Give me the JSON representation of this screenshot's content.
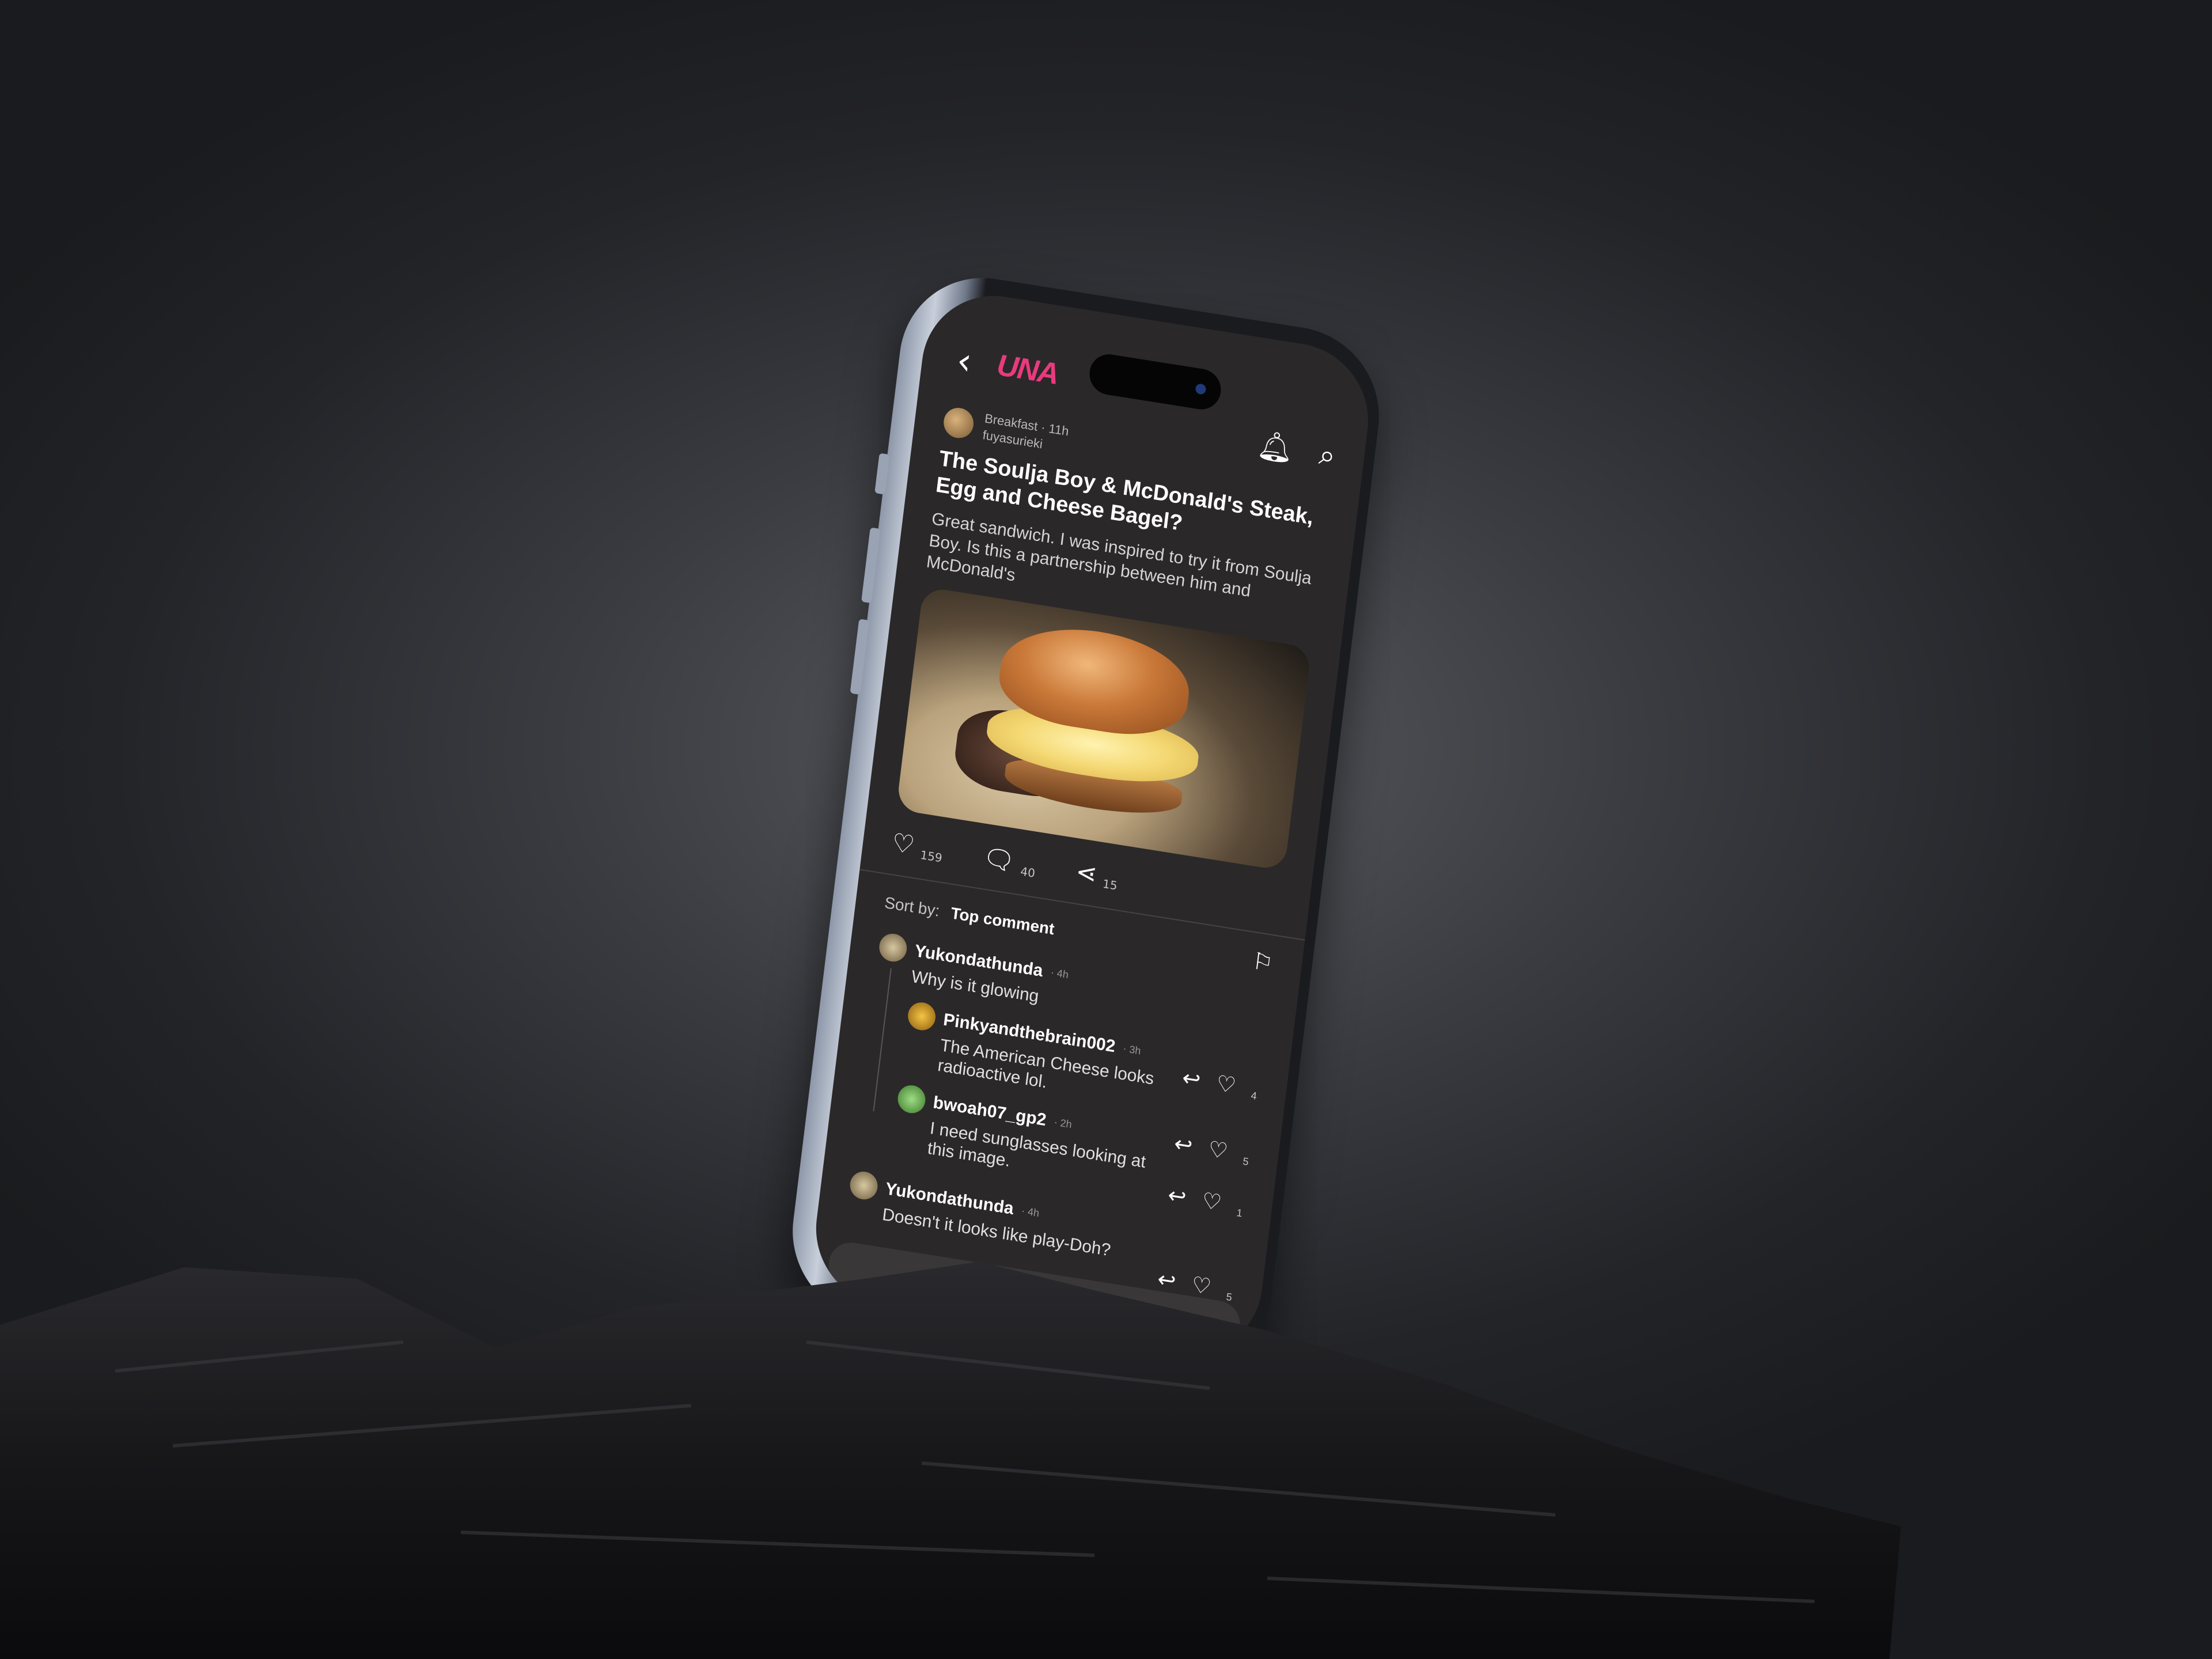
{
  "app": {
    "logo": "UNA"
  },
  "header": {
    "back_icon": "chevron-left-icon",
    "notification_icon": "bell-icon",
    "search_icon": "search-icon"
  },
  "post": {
    "community": "Breakfast",
    "time": "· 11h",
    "author": "fuyasurieki",
    "title": "The Soulja Boy & McDonald's Steak, Egg and Cheese Bagel?",
    "body": "Great sandwich. I was inspired to try it from Soulja Boy. Is this a partnership between him and McDonald's",
    "likes": "159",
    "comments": "40",
    "shares": "15"
  },
  "comments_section": {
    "sort_label": "Sort by:",
    "sort_value": "Top comment",
    "comments": [
      {
        "user": "Yukondathunda",
        "time": "· 4h",
        "text": "Why is it glowing",
        "likes": ""
      },
      {
        "user": "Pinkyandthebrain002",
        "time": "· 3h",
        "text": "The American Cheese looks radioactive lol.",
        "likes": "4"
      },
      {
        "user": "bwoah07_gp2",
        "time": "· 2h",
        "text": "I need sunglasses looking at this image.",
        "likes": "5"
      },
      {
        "user": "Yukondathunda",
        "time": "· 4h",
        "text": "Doesn't it looks like play-Doh?",
        "likes": "1"
      }
    ],
    "last_likes": "5"
  },
  "colors": {
    "accent": "#e93a7d",
    "screen_bg": "#2b2829",
    "text": "#ffffff"
  }
}
